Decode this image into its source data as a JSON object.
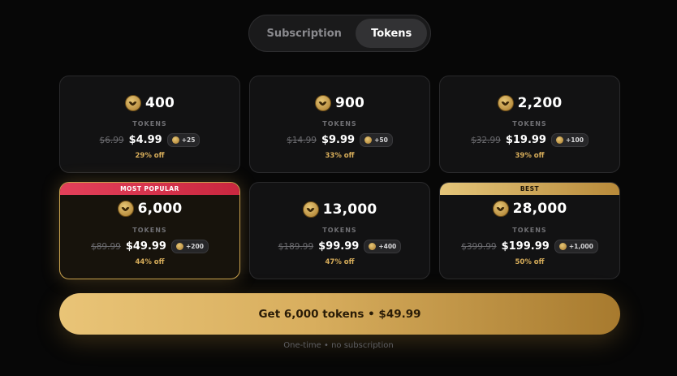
{
  "tabs": {
    "subscription": "Subscription",
    "tokens": "Tokens"
  },
  "tokens_unit": "TOKENS",
  "packs": [
    {
      "amount": "400",
      "unit": "TOKENS",
      "old_price": "$6.99",
      "price": "$4.99",
      "bonus": "+25",
      "discount": "29% off",
      "ribbon": ""
    },
    {
      "amount": "900",
      "unit": "TOKENS",
      "old_price": "$14.99",
      "price": "$9.99",
      "bonus": "+50",
      "discount": "33% off",
      "ribbon": ""
    },
    {
      "amount": "2,200",
      "unit": "TOKENS",
      "old_price": "$32.99",
      "price": "$19.99",
      "bonus": "+100",
      "discount": "39% off",
      "ribbon": ""
    },
    {
      "amount": "6,000",
      "unit": "TOKENS",
      "old_price": "$89.99",
      "price": "$49.99",
      "bonus": "+200",
      "discount": "44% off",
      "ribbon": "MOST POPULAR"
    },
    {
      "amount": "13,000",
      "unit": "TOKENS",
      "old_price": "$189.99",
      "price": "$99.99",
      "bonus": "+400",
      "discount": "47% off",
      "ribbon": ""
    },
    {
      "amount": "28,000",
      "unit": "TOKENS",
      "old_price": "$399.99",
      "price": "$199.99",
      "bonus": "+1,000",
      "discount": "50% off",
      "ribbon": "BEST"
    }
  ],
  "cta": {
    "label": "Get 6,000 tokens • $49.99",
    "note": "One-time • no subscription"
  },
  "colors": {
    "accent_gold": "#d8ae5e",
    "popular_red": "#e3405a",
    "background": "#070707"
  },
  "icons": {
    "coin": "coin-icon",
    "bonus_coin": "bonus-coin-icon"
  }
}
